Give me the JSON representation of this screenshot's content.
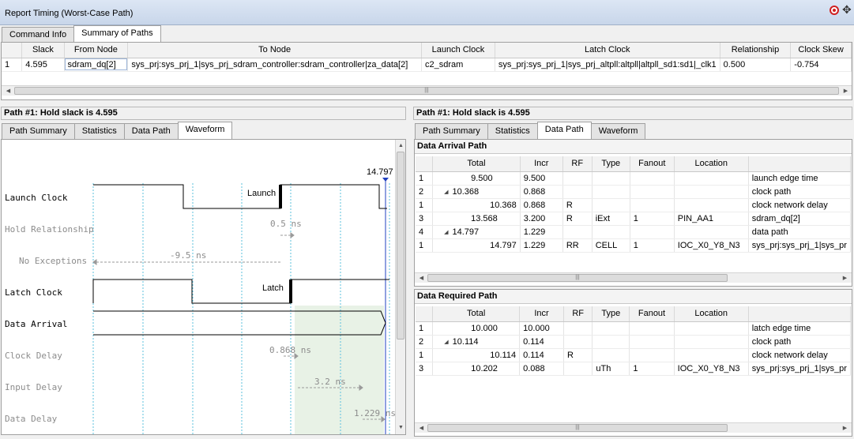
{
  "window": {
    "title": "Report Timing (Worst-Case Path)",
    "close_icon": "close-circle-icon",
    "move_icon": "move-icon"
  },
  "top_tabs": [
    "Command Info",
    "Summary of Paths"
  ],
  "summary": {
    "columns": [
      "",
      "Slack",
      "From Node",
      "To Node",
      "Launch Clock",
      "Latch Clock",
      "Relationship",
      "Clock Skew"
    ],
    "rows": [
      {
        "idx": "1",
        "slack": "4.595",
        "from": "sdram_dq[2]",
        "to": "sys_prj:sys_prj_1|sys_prj_sdram_controller:sdram_controller|za_data[2]",
        "launch": "c2_sdram",
        "latch": "sys_prj:sys_prj_1|sys_prj_altpll:altpll|altpll_sd1:sd1|_clk1",
        "relationship": "0.500",
        "skew": "-0.754"
      }
    ]
  },
  "left_panel": {
    "header": "Path #1: Hold slack is 4.595",
    "tabs": [
      "Path Summary",
      "Statistics",
      "Data Path",
      "Waveform"
    ],
    "active_tab": "Waveform",
    "waveform": {
      "signals": [
        "Launch Clock",
        "Hold Relationship",
        "No Exceptions",
        "Latch Clock",
        "Data Arrival",
        "Clock Delay",
        "Input Delay",
        "Data Delay"
      ],
      "annotations": {
        "time_marker": "14.797 ns",
        "launch": "Launch",
        "latch": "Latch",
        "hold_rel": "0.5 ns",
        "exceptions": "-9.5 ns",
        "clock_delay": "0.868 ns",
        "input_delay": "3.2 ns",
        "data_delay": "1.229 ns"
      }
    }
  },
  "right_panel": {
    "header": "Path #1: Hold slack is 4.595",
    "tabs": [
      "Path Summary",
      "Statistics",
      "Data Path",
      "Waveform"
    ],
    "active_tab": "Data Path",
    "columns": [
      "",
      "Total",
      "Incr",
      "RF",
      "Type",
      "Fanout",
      "Location",
      ""
    ],
    "arrival": {
      "title": "Data Arrival Path",
      "rows": [
        {
          "idx": "1",
          "tree": false,
          "total": "9.500",
          "incr": "9.500",
          "rf": "",
          "type": "",
          "fanout": "",
          "location": "",
          "element": "launch edge time"
        },
        {
          "idx": "2",
          "tree": true,
          "total": "10.368",
          "incr": "0.868",
          "rf": "",
          "type": "",
          "fanout": "",
          "location": "",
          "element": "clock path"
        },
        {
          "idx": "1",
          "tree": false,
          "total": "10.368",
          "incr": "0.868",
          "rf": "R",
          "type": "",
          "fanout": "",
          "location": "",
          "element": "clock network delay"
        },
        {
          "idx": "3",
          "tree": false,
          "total": "13.568",
          "incr": "3.200",
          "rf": "R",
          "type": "iExt",
          "fanout": "1",
          "location": "PIN_AA1",
          "element": "sdram_dq[2]"
        },
        {
          "idx": "4",
          "tree": true,
          "total": "14.797",
          "incr": "1.229",
          "rf": "",
          "type": "",
          "fanout": "",
          "location": "",
          "element": "data path"
        },
        {
          "idx": "1",
          "tree": false,
          "total": "14.797",
          "incr": "1.229",
          "rf": "RR",
          "type": "CELL",
          "fanout": "1",
          "location": "IOC_X0_Y8_N3",
          "element": "sys_prj:sys_prj_1|sys_pr"
        }
      ]
    },
    "required": {
      "title": "Data Required Path",
      "rows": [
        {
          "idx": "1",
          "tree": false,
          "total": "10.000",
          "incr": "10.000",
          "rf": "",
          "type": "",
          "fanout": "",
          "location": "",
          "element": "latch edge time"
        },
        {
          "idx": "2",
          "tree": true,
          "total": "10.114",
          "incr": "0.114",
          "rf": "",
          "type": "",
          "fanout": "",
          "location": "",
          "element": "clock path"
        },
        {
          "idx": "1",
          "tree": false,
          "total": "10.114",
          "incr": "0.114",
          "rf": "R",
          "type": "",
          "fanout": "",
          "location": "",
          "element": "clock network delay"
        },
        {
          "idx": "3",
          "tree": false,
          "total": "10.202",
          "incr": "0.088",
          "rf": "",
          "type": "uTh",
          "fanout": "1",
          "location": "IOC_X0_Y8_N3",
          "element": "sys_prj:sys_prj_1|sys_pr"
        }
      ]
    }
  },
  "colors": {
    "highlight": "#e8f2e6",
    "dotted_grid": "#5bc0de",
    "marker": "#2040c0"
  }
}
